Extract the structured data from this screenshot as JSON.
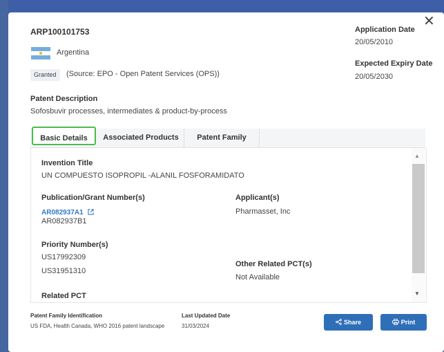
{
  "modal": {
    "patent_id": "ARP100101753",
    "close_symbol": "✕",
    "country": "Argentina",
    "status_badge": "Granted",
    "source": "(Source: EPO - Open Patent Services (OPS))",
    "application_date_label": "Application Date",
    "application_date": "20/05/2010",
    "expiry_date_label": "Expected Expiry Date",
    "expiry_date": "20/05/2030",
    "description_label": "Patent Description",
    "description": "Sofosbuvir processes, intermediates & product-by-process"
  },
  "tabs": {
    "basic": "Basic Details",
    "associated": "Associated Products",
    "family": "Patent Family"
  },
  "details": {
    "invention_title_label": "Invention Title",
    "invention_title": "UN COMPUESTO ISOPROPIL -ALANIL FOSFORAMIDATO",
    "publication_label": "Publication/Grant Number(s)",
    "publication_link": "AR082937A1",
    "publication_2": "AR082937B1",
    "applicant_label": "Applicant(s)",
    "applicant": "Pharmasset, Inc",
    "priority_label": "Priority Number(s)",
    "priority_1": "US17992309",
    "priority_2": "US31951310",
    "other_pct_label": "Other Related PCT(s)",
    "other_pct": "Not Available",
    "related_pct_label": "Related PCT"
  },
  "footer": {
    "family_id_label": "Patent Family Identification",
    "family_id_value": "US FDA, Health Canada, WHO 2016 patent landscape",
    "updated_label": "Last Updated Date",
    "updated_value": "31/03/2024",
    "share_label": "Share",
    "print_label": "Print"
  },
  "icons": {
    "close": "close-icon",
    "flag": "argentina-flag-icon",
    "external_link": "external-link-icon",
    "share": "share-icon",
    "print": "print-icon"
  },
  "colors": {
    "accent": "#2f6fb8",
    "active_tab_outline": "#4cbb4c",
    "link": "#3578c8",
    "backdrop": "#3e5ea8"
  }
}
